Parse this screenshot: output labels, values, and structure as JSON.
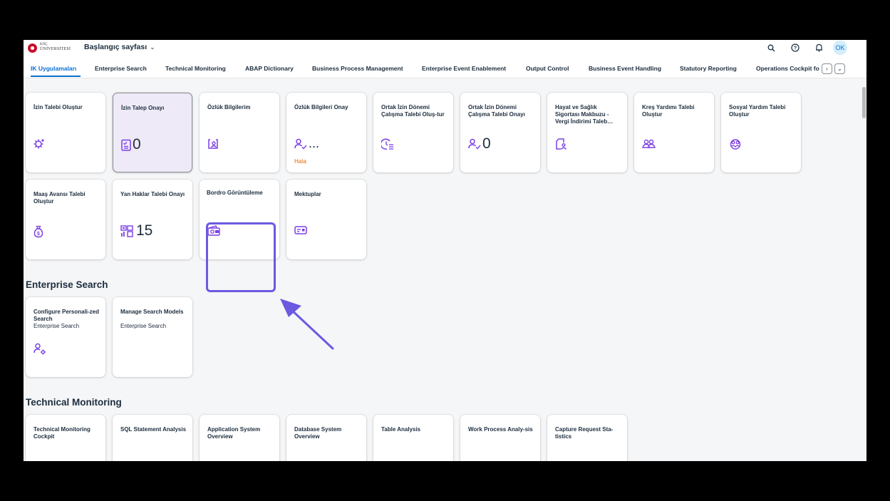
{
  "logo": {
    "line1": "KOÇ",
    "line2": "ÜNİVERSİTESİ"
  },
  "shellbar": {
    "title": "Başlangıç sayfası",
    "avatar": "OK",
    "icons": [
      "search-icon",
      "help-icon",
      "bell-icon"
    ]
  },
  "tabs": [
    "IK Uygulamaları",
    "Enterprise Search",
    "Technical Monitoring",
    "ABAP Dictionary",
    "Business Process Management",
    "Enterprise Event Enablement",
    "Output Control",
    "Business Event Handling",
    "Statutory Reporting",
    "Operations Cockpit fo"
  ],
  "sections": {
    "ik": {
      "tiles": [
        {
          "title": "İzin Talebi Oluştur",
          "icon": "gear-plus-icon"
        },
        {
          "title": "İzin Talep Onayı",
          "icon": "checklist-icon",
          "number": "0"
        },
        {
          "title": "Özlük Bilgilerim",
          "icon": "id-card-icon"
        },
        {
          "title": "Özlük Bilgileri Onay",
          "icon": "person-check-icon",
          "number": "...",
          "status": "Hata"
        },
        {
          "title": "Ortak İzin Dönemi Çalışma Talebi Oluş-tur",
          "icon": "time-list-icon"
        },
        {
          "title": "Ortak İzin Dönemi Çalışma Talebi Onayı",
          "icon": "person-check-icon",
          "number": "0"
        },
        {
          "title": "Hayat ve Sağlık Sigortası Makbuzu - Vergi İndirimi Taleb…",
          "icon": "document-person-icon"
        },
        {
          "title": "Kreş Yardımı Talebi Oluştur",
          "icon": "group-icon"
        },
        {
          "title": "Sosyal Yardım Talebi Oluştur",
          "icon": "people-circle-icon"
        },
        {
          "title": "Maaş Avansı Talebi Oluştur",
          "icon": "money-bag-icon"
        },
        {
          "title": "Yan Haklar Talebi Onayı",
          "icon": "dashboard-icon",
          "number": "15"
        },
        {
          "title": "Bordro Görüntüleme",
          "icon": "wallet-icon"
        },
        {
          "title": "Mektuplar",
          "icon": "message-card-icon"
        }
      ]
    },
    "enterprise_search": {
      "title": "Enterprise Search",
      "tiles": [
        {
          "title": "Configure Personali-zed Search",
          "subtitle": "Enterprise Search",
          "icon": "person-settings-icon"
        },
        {
          "title": "Manage Search Models",
          "subtitle": "Enterprise Search"
        }
      ]
    },
    "technical_monitoring": {
      "title": "Technical Monitoring",
      "tiles": [
        {
          "title": "Technical Monitoring Cockpit"
        },
        {
          "title": "SQL Statement Analysis"
        },
        {
          "title": "Application System Overview"
        },
        {
          "title": "Database System Overview"
        },
        {
          "title": "Table Analysis"
        },
        {
          "title": "Work Process Analy-sis"
        },
        {
          "title": "Capture Request Sta-tistics"
        }
      ]
    }
  },
  "colors": {
    "accent": "#0a6ed1",
    "icon": "#7b3fe4",
    "error": "#e76500",
    "annotation": "#6a5ae0"
  }
}
